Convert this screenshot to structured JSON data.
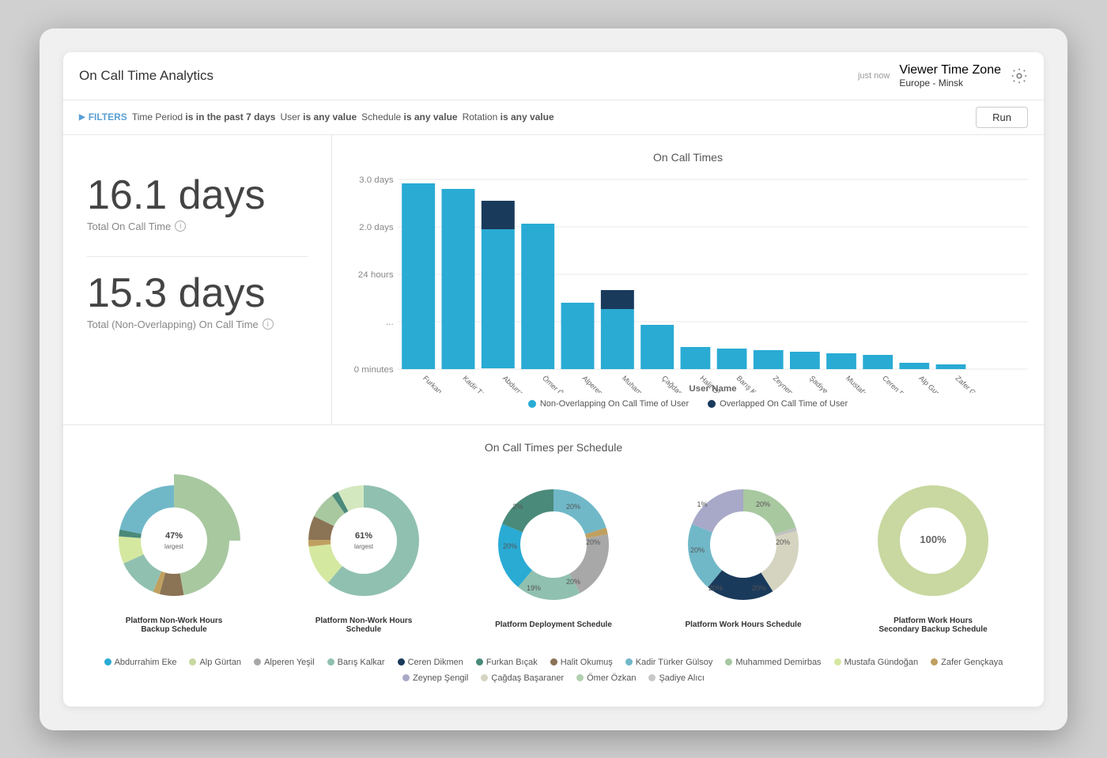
{
  "header": {
    "title": "On Call Time Analytics",
    "time_label": "just now",
    "tz_label": "Viewer Time Zone",
    "tz_value": "Europe - Minsk"
  },
  "filters": {
    "label": "FILTERS",
    "items": [
      {
        "key": "Time Period",
        "value": "is in the past 7 days"
      },
      {
        "key": "User",
        "value": "is any value"
      },
      {
        "key": "Schedule",
        "value": "is any value"
      },
      {
        "key": "Rotation",
        "value": "is any value"
      }
    ],
    "run_label": "Run"
  },
  "stats": [
    {
      "value": "16.1 days",
      "label": "Total On Call Time",
      "has_info": true
    },
    {
      "value": "15.3 days",
      "label": "Total (Non-Overlapping) On Call Time",
      "has_info": true
    }
  ],
  "bar_chart": {
    "title": "On Call Times",
    "y_labels": [
      "0 minutes",
      "24 hours",
      "2.0 days",
      "3.0 days"
    ],
    "x_axis_title": "User Name",
    "legend": [
      {
        "color": "#29ABD4",
        "label": "Non-Overlapping On Call Time of User"
      },
      {
        "color": "#1a3a5c",
        "label": "Overlapped On Call Time of User"
      }
    ],
    "bars": [
      {
        "name": "Furkan Bıçak",
        "non_overlap": 2.95,
        "overlap": 0.0
      },
      {
        "name": "Kadir Türker Gülsoy",
        "non_overlap": 2.85,
        "overlap": 0.0
      },
      {
        "name": "Abdurrahim Eke",
        "non_overlap": 2.2,
        "overlap": 0.45
      },
      {
        "name": "Ömer Özkan",
        "non_overlap": 2.3,
        "overlap": 0.0
      },
      {
        "name": "Alperen Yeşil",
        "non_overlap": 1.05,
        "overlap": 0.0
      },
      {
        "name": "Muhammed Demirbas",
        "non_overlap": 0.95,
        "overlap": 0.3
      },
      {
        "name": "Çağdaş Başaraner",
        "non_overlap": 0.7,
        "overlap": 0.0
      },
      {
        "name": "Halit Okumuş",
        "non_overlap": 0.35,
        "overlap": 0.0
      },
      {
        "name": "Barış Kalkar",
        "non_overlap": 0.33,
        "overlap": 0.0
      },
      {
        "name": "Zeynep Şengil",
        "non_overlap": 0.3,
        "overlap": 0.0
      },
      {
        "name": "Şadiye Alıcı",
        "non_overlap": 0.28,
        "overlap": 0.0
      },
      {
        "name": "Mustafa Gündoğan",
        "non_overlap": 0.25,
        "overlap": 0.0
      },
      {
        "name": "Ceren Dikmen",
        "non_overlap": 0.22,
        "overlap": 0.0
      },
      {
        "name": "Alp Gurtan",
        "non_overlap": 0.1,
        "overlap": 0.0
      },
      {
        "name": "Zafer Gençkaya",
        "non_overlap": 0.08,
        "overlap": 0.0
      }
    ]
  },
  "donut_section": {
    "title": "On Call Times per Schedule",
    "charts": [
      {
        "label": "Platform Non-Work Hours Backup Schedule",
        "segments": [
          {
            "pct": 47,
            "color": "#a8c8a0"
          },
          {
            "pct": 7,
            "color": "#8b7355"
          },
          {
            "pct": 2,
            "color": "#c0a060"
          },
          {
            "pct": 12,
            "color": "#90c0b0"
          },
          {
            "pct": 8,
            "color": "#d4e8a0"
          },
          {
            "pct": 2,
            "color": "#4a8a7a"
          },
          {
            "pct": 22,
            "color": "#70b8c8"
          }
        ]
      },
      {
        "label": "Platform Non-Work Hours Schedule",
        "segments": [
          {
            "pct": 61,
            "color": "#90c0b0"
          },
          {
            "pct": 12,
            "color": "#d4e8a0"
          },
          {
            "pct": 2,
            "color": "#c0a060"
          },
          {
            "pct": 7,
            "color": "#8b7355"
          },
          {
            "pct": 8,
            "color": "#a8c8a0"
          },
          {
            "pct": 2,
            "color": "#4a8a7a"
          },
          {
            "pct": 8,
            "color": "#d4e8a0"
          }
        ]
      },
      {
        "label": "Platform Deployment Schedule",
        "segments": [
          {
            "pct": 20,
            "color": "#70b8c8"
          },
          {
            "pct": 2,
            "color": "#c0a060"
          },
          {
            "pct": 20,
            "color": "#a8a8a8"
          },
          {
            "pct": 19,
            "color": "#90c0b0"
          },
          {
            "pct": 20,
            "color": "#70b8c8"
          },
          {
            "pct": 20,
            "color": "#4a8a7a"
          },
          {
            "pct": 1,
            "color": "#a8c8a0"
          }
        ]
      },
      {
        "label": "Platform Work Hours Schedule",
        "segments": [
          {
            "pct": 20,
            "color": "#a8c8a0"
          },
          {
            "pct": 1,
            "color": "#c0c0c0"
          },
          {
            "pct": 20,
            "color": "#d4d4c0"
          },
          {
            "pct": 20,
            "color": "#1a3a5c"
          },
          {
            "pct": 20,
            "color": "#70b8c8"
          },
          {
            "pct": 20,
            "color": "#a8a8c8"
          }
        ]
      },
      {
        "label": "Platform Work Hours Secondary Backup Schedule",
        "segments": [
          {
            "pct": 100,
            "color": "#c8d8a0"
          }
        ],
        "center_label": "100%"
      }
    ]
  },
  "color_legend": [
    {
      "color": "#29ABD4",
      "label": "Abdurrahim Eke"
    },
    {
      "color": "#c8d8a0",
      "label": "Alp Gürtan"
    },
    {
      "color": "#a8a8a8",
      "label": "Alperen Yeşil"
    },
    {
      "color": "#90c0b0",
      "label": "Barış Kalkar"
    },
    {
      "color": "#1a3a5c",
      "label": "Ceren Dikmen"
    },
    {
      "color": "#4a8a7a",
      "label": "Furkan Bıçak"
    },
    {
      "color": "#8b7355",
      "label": "Halit Okumuş"
    },
    {
      "color": "#70b8c8",
      "label": "Kadir Türker Gülsoy"
    },
    {
      "color": "#a8c8a0",
      "label": "Muhammed Demirbas"
    },
    {
      "color": "#d4e8a0",
      "label": "Mustafa Gündoğan"
    },
    {
      "color": "#c0a060",
      "label": "Zafer Gençkaya"
    },
    {
      "color": "#a8a8c8",
      "label": "Zeynep Şengil"
    },
    {
      "color": "#d4d4c0",
      "label": "Çağdaş Başaraner"
    },
    {
      "color": "#b0d0b0",
      "label": "Ömer Özkan"
    },
    {
      "color": "#c8c8c8",
      "label": "Şadiye Alıcı"
    }
  ]
}
